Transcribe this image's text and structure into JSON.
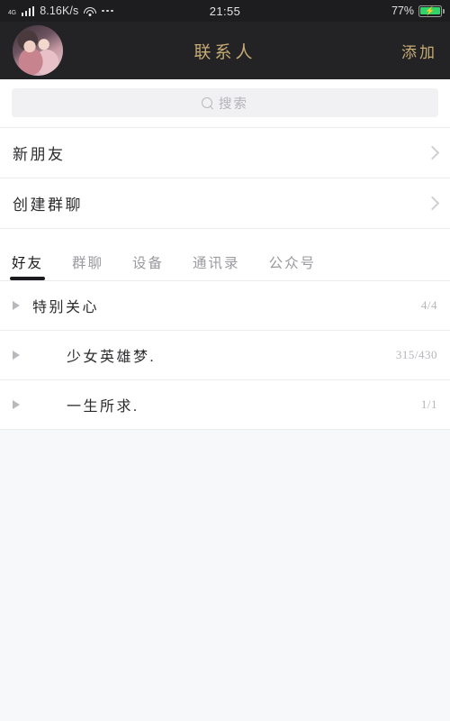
{
  "statusbar": {
    "network_type": "4G",
    "data_speed": "8.16K/s",
    "signal_icon": "signal-bars-icon",
    "wifi_icon": "wifi-icon",
    "more_icon": "ellipsis-icon",
    "time": "21:55",
    "battery_percent": "77%",
    "battery_icon": "battery-charging-icon",
    "charging_glyph": "⚡"
  },
  "header": {
    "avatar_name": "user-avatar",
    "title": "联系人",
    "action_label": "添加",
    "accent_color": "#c6ab75",
    "background_color": "#232326"
  },
  "search": {
    "icon": "search-icon",
    "placeholder": "搜索"
  },
  "nav_rows": [
    {
      "label": "新朋友",
      "chevron": "chevron-right-icon"
    },
    {
      "label": "创建群聊",
      "chevron": "chevron-right-icon"
    }
  ],
  "tabs": [
    {
      "label": "好友",
      "active": true
    },
    {
      "label": "群聊",
      "active": false
    },
    {
      "label": "设备",
      "active": false
    },
    {
      "label": "通讯录",
      "active": false
    },
    {
      "label": "公众号",
      "active": false
    }
  ],
  "groups": [
    {
      "label": "特别关心",
      "count": "4/4",
      "indent": false,
      "expander": "triangle-right-icon"
    },
    {
      "label": "少女英雄梦.",
      "count": "315/430",
      "indent": true,
      "expander": "triangle-right-icon"
    },
    {
      "label": "一生所求.",
      "count": "1/1",
      "indent": true,
      "expander": "triangle-right-icon"
    }
  ]
}
